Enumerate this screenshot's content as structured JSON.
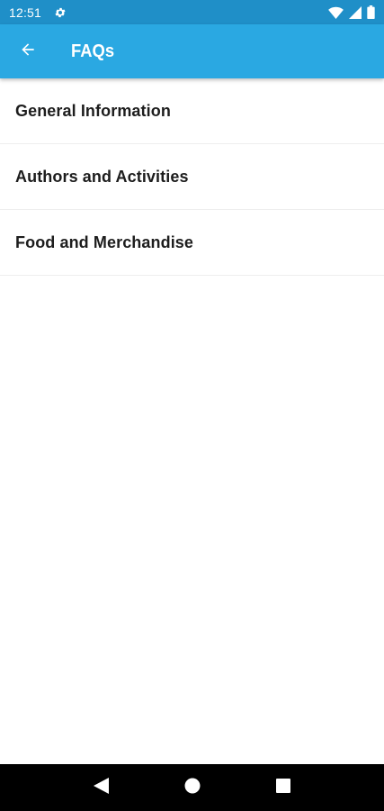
{
  "status_bar": {
    "time": "12:51",
    "icons": [
      "gear-icon",
      "wifi-icon",
      "signal-icon",
      "battery-icon"
    ]
  },
  "app_bar": {
    "title": "FAQs",
    "back_icon": "arrow-left-icon",
    "background_color": "#2aa8e2"
  },
  "faq_items": [
    {
      "label": "General Information"
    },
    {
      "label": "Authors and Activities"
    },
    {
      "label": "Food and Merchandise"
    }
  ],
  "nav_bar": {
    "icons": [
      "back-triangle-icon",
      "home-circle-icon",
      "recents-square-icon"
    ]
  }
}
